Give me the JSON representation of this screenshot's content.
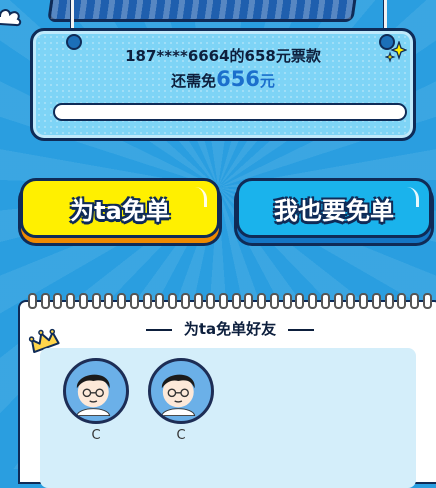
{
  "info": {
    "line1": "187****6664的658元票款",
    "line2_prefix": "还需免",
    "remaining_amount": "656",
    "remaining_unit": "元",
    "progress_fraction": 0.0
  },
  "buttons": {
    "free_for_ta": "为ta免单",
    "me_too": "我也要免单"
  },
  "friends": {
    "title": "为ta免单好友",
    "list": [
      {
        "name": "C"
      },
      {
        "name": "C"
      }
    ]
  },
  "colors": {
    "background": "#2a9ee0",
    "card": "#7ed4f6",
    "yellow_button": "#fff000",
    "blue_button": "#1ab3ec",
    "amount": "#1b6fcc",
    "outline": "#0f2b57"
  }
}
